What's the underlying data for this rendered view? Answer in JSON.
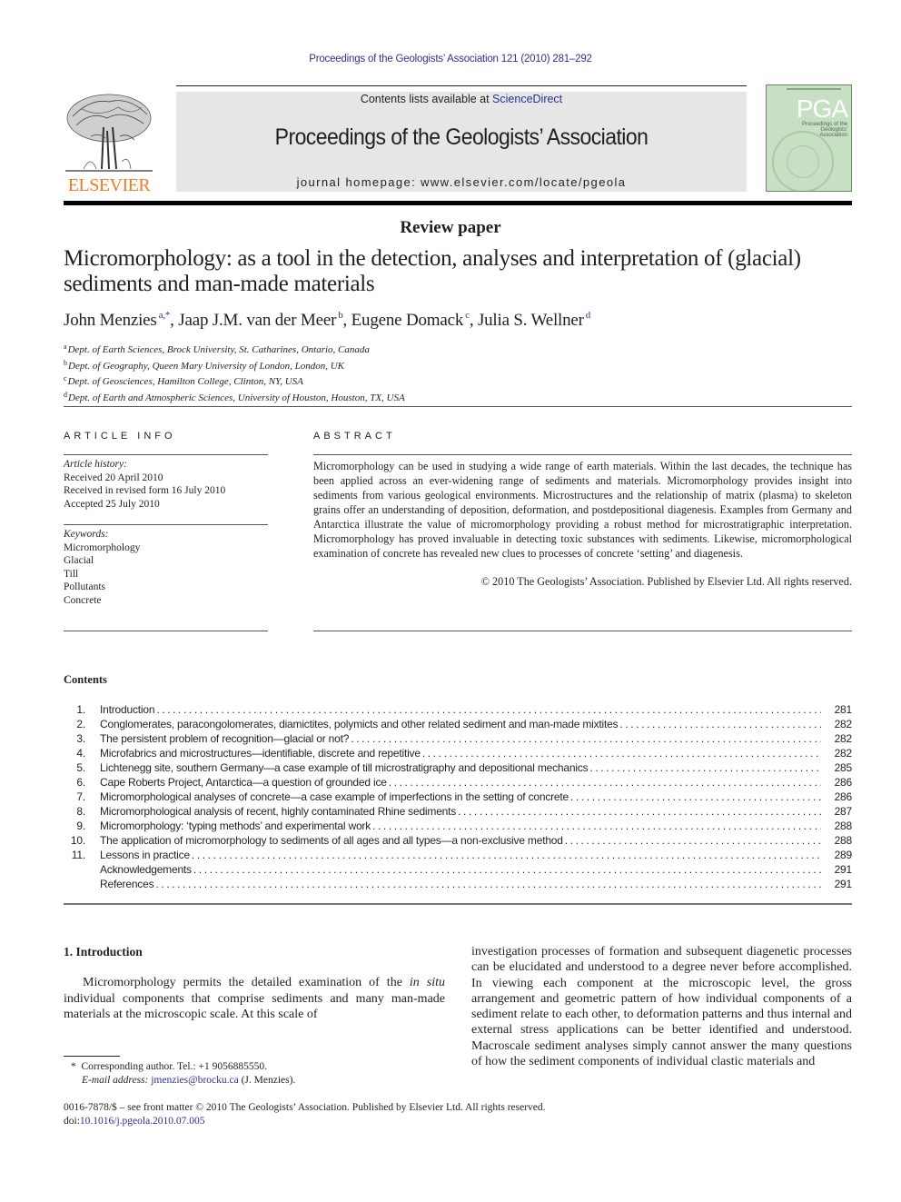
{
  "running_head": "Proceedings of the Geologists’ Association 121 (2010) 281–292",
  "masthead": {
    "publisher_logo_text": "ELSEVIER",
    "contents_available_prefix": "Contents lists available at ",
    "contents_available_link": "ScienceDirect",
    "journal_title": "Proceedings of the Geologists’ Association",
    "homepage": "journal homepage: www.elsevier.com/locate/pgeola",
    "cover": {
      "acronym": "PGA",
      "subtitle": "Proceedings of the Geologists' Association"
    }
  },
  "article": {
    "type": "Review paper",
    "title": "Micromorphology: as a tool in the detection, analyses and interpretation of (glacial) sediments and man-made materials",
    "authors": [
      {
        "name": "John Menzies",
        "sup": "a,*",
        "sep": ", "
      },
      {
        "name": "Jaap J.M. van der Meer",
        "sup": "b",
        "sep": ", "
      },
      {
        "name": "Eugene Domack",
        "sup": "c",
        "sep": ", "
      },
      {
        "name": "Julia S. Wellner",
        "sup": "d",
        "sep": ""
      }
    ],
    "affiliations": [
      {
        "sup": "a",
        "text": "Dept. of Earth Sciences, Brock University, St. Catharines, Ontario, Canada"
      },
      {
        "sup": "b",
        "text": "Dept. of Geography, Queen Mary University of London, London, UK"
      },
      {
        "sup": "c",
        "text": "Dept. of Geosciences, Hamilton College, Clinton, NY, USA"
      },
      {
        "sup": "d",
        "text": "Dept. of Earth and Atmospheric Sciences, University of Houston, Houston, TX, USA"
      }
    ]
  },
  "article_info": {
    "heading": "ARTICLE INFO",
    "history_label": "Article history:",
    "history": [
      "Received 20 April 2010",
      "Received in revised form 16 July 2010",
      "Accepted 25 July 2010"
    ],
    "keywords_label": "Keywords:",
    "keywords": [
      "Micromorphology",
      "Glacial",
      "Till",
      "Pollutants",
      "Concrete"
    ]
  },
  "abstract": {
    "heading": "ABSTRACT",
    "text": "Micromorphology can be used in studying a wide range of earth materials. Within the last decades, the technique has been applied across an ever-widening range of sediments and materials. Micromorphology provides insight into sediments from various geological environments. Microstructures and the relationship of matrix (plasma) to skeleton grains offer an understanding of deposition, deformation, and postdepositional diagenesis. Examples from Germany and Antarctica illustrate the value of micromorphology providing a robust method for microstratigraphic interpretation. Micromorphology has proved invaluable in detecting toxic substances with sediments. Likewise, micromorphological examination of concrete has revealed new clues to processes of concrete ‘setting’ and diagenesis.",
    "copyright": "© 2010 The Geologists’ Association. Published by Elsevier Ltd. All rights reserved."
  },
  "contents": {
    "heading": "Contents",
    "entries": [
      {
        "num": "1.",
        "title": "Introduction",
        "page": "281"
      },
      {
        "num": "2.",
        "title": "Conglomerates, paracongolomerates, diamictites, polymicts and other related sediment and man-made mixtites",
        "page": "282"
      },
      {
        "num": "3.",
        "title": "The persistent problem of recognition—glacial or not?",
        "page": "282"
      },
      {
        "num": "4.",
        "title": "Microfabrics and microstructures—identifiable, discrete and repetitive",
        "page": "282"
      },
      {
        "num": "5.",
        "title": "Lichtenegg site, southern Germany—a case example of till microstratigraphy and depositional mechanics",
        "page": "285"
      },
      {
        "num": "6.",
        "title": "Cape Roberts Project, Antarctica—a question of grounded ice",
        "page": "286"
      },
      {
        "num": "7.",
        "title": "Micromorphological analyses of concrete—a case example of imperfections in the setting of concrete",
        "page": "286"
      },
      {
        "num": "8.",
        "title": "Micromorphological analysis of recent, highly contaminated Rhine sediments",
        "page": "287"
      },
      {
        "num": "9.",
        "title": "Micromorphology: ‘typing methods’ and experimental work",
        "page": "288"
      },
      {
        "num": "10.",
        "title": "The application of micromorphology to sediments of all ages and all types—a non-exclusive method",
        "page": "288"
      },
      {
        "num": "11.",
        "title": "Lessons in practice",
        "page": "289"
      },
      {
        "num": "",
        "title": "Acknowledgements",
        "page": "291"
      },
      {
        "num": "",
        "title": "References",
        "page": "291"
      }
    ]
  },
  "body": {
    "section_heading": "1.  Introduction",
    "left_col_pre": "Micromorphology permits the detailed examination of the ",
    "left_col_italic": "in situ",
    "left_col_post": " individual components that comprise sediments and many man-made materials at the microscopic scale. At this scale of",
    "right_col": "investigation processes of formation and subsequent diagenetic processes can be elucidated and understood to a degree never before accomplished. In viewing each component at the microscopic level, the gross arrangement and geometric pattern of how individual components of a sediment relate to each other, to deformation patterns and thus internal and external stress applications can be better identified and understood. Macroscale sediment analyses simply cannot answer the many questions of how the sediment components of individual clastic materials and"
  },
  "footnote": {
    "marker": "*",
    "corresponding": "Corresponding author. Tel.: +1 9056885550.",
    "email_label": "E-mail address:",
    "email": "jmenzies@brocku.ca",
    "email_suffix": " (J. Menzies)."
  },
  "front_matter": {
    "issn_line": "0016-7878/$ – see front matter © 2010 The Geologists’ Association. Published by Elsevier Ltd. All rights reserved.",
    "doi_prefix": "doi:",
    "doi": "10.1016/j.pgeola.2010.07.005"
  },
  "colors": {
    "link": "#2e3192",
    "elsevier_orange": "#f47920",
    "masthead_gray": "#e6e6e6",
    "cover_green": "#c7dfc3"
  }
}
